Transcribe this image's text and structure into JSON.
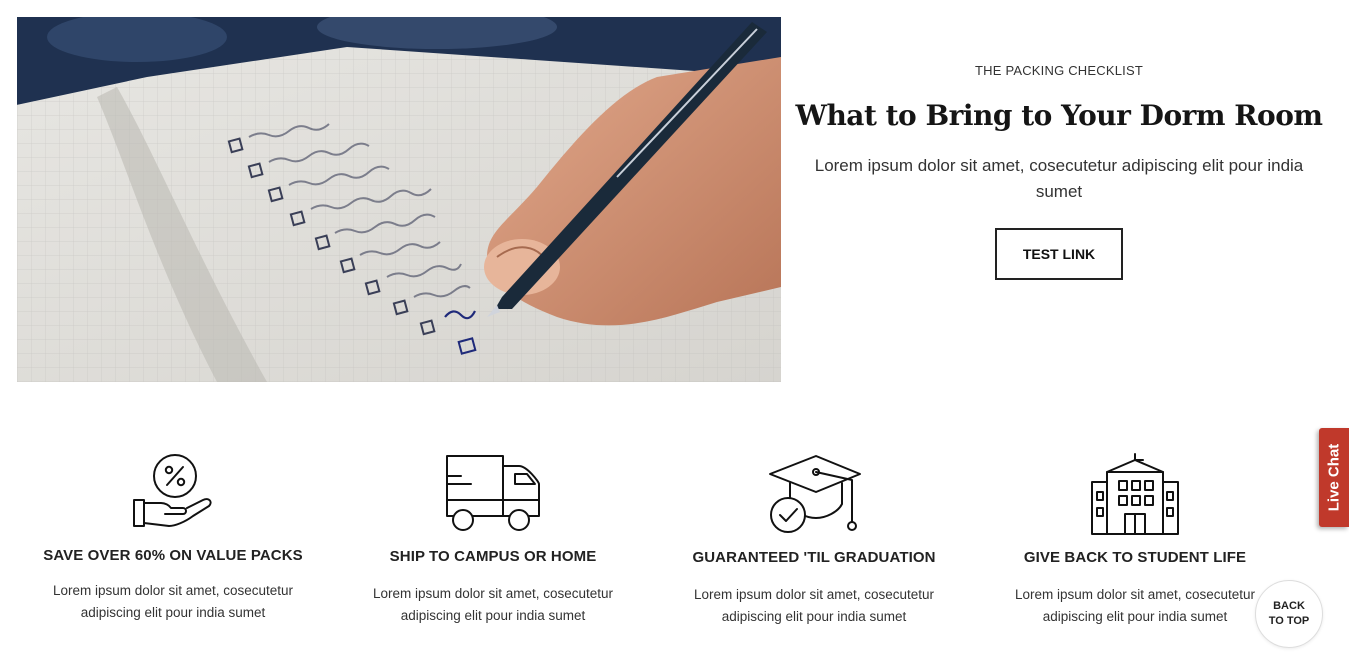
{
  "hero": {
    "eyebrow": "THE PACKING CHECKLIST",
    "title": "What to Bring to Your Dorm Room",
    "description": "Lorem ipsum dolor sit amet, cosecutetur adipiscing elit pour india sumet",
    "link_label": "TEST LINK",
    "image_alt_icon": "notebook-checklist-photo"
  },
  "features": [
    {
      "icon": "percent-hand-icon",
      "title": "SAVE OVER 60% ON VALUE PACKS",
      "description": "Lorem ipsum dolor sit amet, cosecutetur adipiscing elit pour india sumet"
    },
    {
      "icon": "delivery-truck-icon",
      "title": "SHIP TO CAMPUS OR HOME",
      "description": "Lorem ipsum dolor sit amet, cosecutetur adipiscing elit pour india sumet"
    },
    {
      "icon": "graduation-cap-icon",
      "title": "GUARANTEED 'TIL GRADUATION",
      "description": "Lorem ipsum dolor sit amet, cosecutetur adipiscing elit pour india sumet"
    },
    {
      "icon": "school-building-icon",
      "title": "GIVE BACK TO STUDENT LIFE",
      "description": "Lorem ipsum dolor sit amet, cosecutetur adipiscing elit pour india sumet"
    }
  ],
  "live_chat": {
    "label": "Live Chat",
    "color": "#c0392b"
  },
  "back_to_top": {
    "label": "BACK TO TOP"
  }
}
